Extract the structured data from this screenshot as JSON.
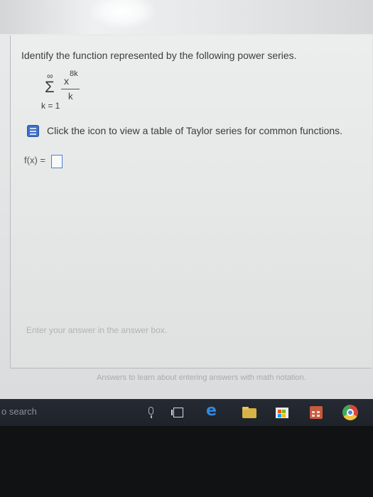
{
  "question": {
    "prompt": "Identify the function represented by the following power series."
  },
  "series": {
    "upper_limit": "∞",
    "sigma": "Σ",
    "lower_limit": "k = 1",
    "numerator_base": "x",
    "numerator_exponent": "8k",
    "denominator": "k"
  },
  "hint": {
    "text": "Click the icon to view a table of Taylor series for common functions."
  },
  "answer": {
    "label": "f(x) =",
    "value": ""
  },
  "status": {
    "message": "Enter your answer in the answer box."
  },
  "help": {
    "link_text": "Answers to learn about entering answers with math notation."
  },
  "taskbar": {
    "search_placeholder": "o search",
    "icons": [
      "microphone-icon",
      "task-view-icon",
      "edge-icon",
      "file-explorer-icon",
      "store-icon",
      "calculator-icon",
      "chrome-icon"
    ]
  },
  "colors": {
    "hint_icon": "#3d70c9",
    "answer_box_border": "#4d7fd6",
    "taskbar": "#22262e"
  }
}
